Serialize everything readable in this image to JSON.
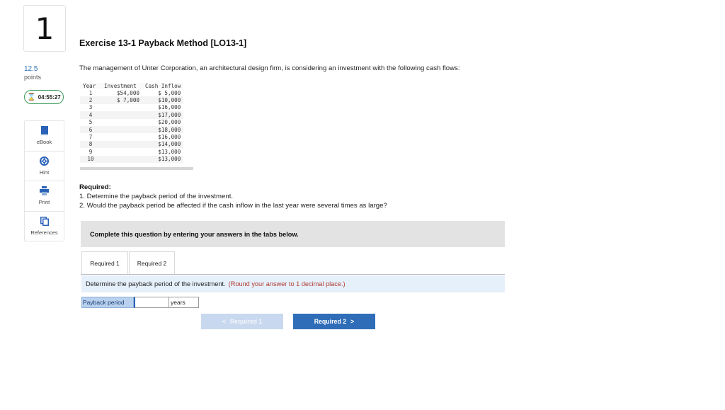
{
  "question": {
    "number": "1",
    "points_value": "12.5",
    "points_label": "points",
    "timer": "04:55:27"
  },
  "tools": [
    {
      "label": "eBook",
      "icon": "ebook-icon"
    },
    {
      "label": "Hint",
      "icon": "hint-icon"
    },
    {
      "label": "Print",
      "icon": "print-icon"
    },
    {
      "label": "References",
      "icon": "references-icon"
    }
  ],
  "exercise": {
    "title": "Exercise 13-1 Payback Method [LO13-1]",
    "intro": "The management of Unter Corporation, an architectural design firm, is considering an investment with the following cash flows:"
  },
  "cash_flow_table": {
    "headers": [
      "Year",
      "Investment",
      "Cash Inflow"
    ],
    "rows": [
      [
        "1",
        "$54,000",
        "$ 5,000"
      ],
      [
        "2",
        "$ 7,000",
        "$10,000"
      ],
      [
        "3",
        "",
        "$16,000"
      ],
      [
        "4",
        "",
        "$17,000"
      ],
      [
        "5",
        "",
        "$20,000"
      ],
      [
        "6",
        "",
        "$18,000"
      ],
      [
        "7",
        "",
        "$16,000"
      ],
      [
        "8",
        "",
        "$14,000"
      ],
      [
        "9",
        "",
        "$13,000"
      ],
      [
        "10",
        "",
        "$13,000"
      ]
    ]
  },
  "required": {
    "heading": "Required:",
    "item1": "1. Determine the payback period of the investment.",
    "item2": "2. Would the payback period be affected if the cash inflow in the last year were several times as large?"
  },
  "complete_banner": "Complete this question by entering your answers in the tabs below.",
  "tabs": [
    {
      "label": "Required 1",
      "active": true
    },
    {
      "label": "Required 2",
      "active": false
    }
  ],
  "instruction": {
    "text": "Determine the payback period of the investment.",
    "note": "(Round your answer to 1 decimal place.)"
  },
  "answer": {
    "label": "Payback period",
    "value": "",
    "unit": "years"
  },
  "nav": {
    "prev_label": "Required 1",
    "next_label": "Required 2"
  },
  "colors": {
    "accent": "#2f6db8",
    "timer_border": "#3a9a5b",
    "note": "#b03a2e",
    "instruction_bg": "#e6f0fb"
  }
}
